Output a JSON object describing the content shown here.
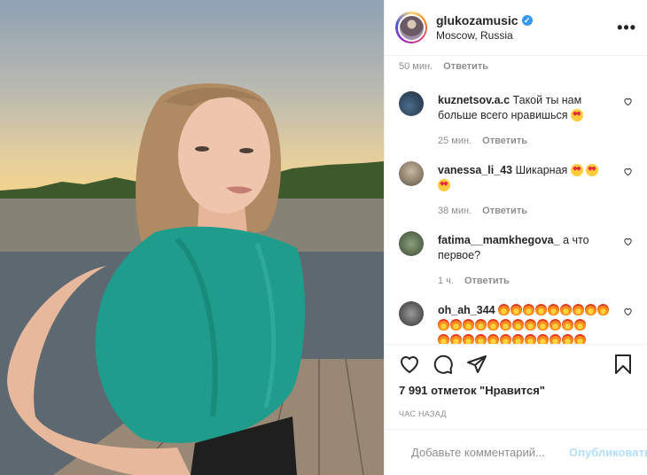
{
  "header": {
    "username": "glukozamusic",
    "location": "Moscow, Russia",
    "more_label": "•••"
  },
  "comments": [
    {
      "username": "",
      "text": "",
      "time": "50 мин.",
      "reply": "Ответить"
    },
    {
      "username": "kuznetsov.a.c",
      "text": "Такой ты нам больше всего нравишься",
      "time": "25 мин.",
      "reply": "Ответить"
    },
    {
      "username": "vanessa_li_43",
      "text": "Шикарная",
      "time": "38 мин.",
      "reply": "Ответить"
    },
    {
      "username": "fatima__mamkhegova_",
      "text": "а что первое?",
      "time": "1 ч.",
      "reply": "Ответить"
    },
    {
      "username": "oh_ah_344",
      "text": "",
      "time": "",
      "reply": ""
    }
  ],
  "likes": "7 991 отметок \"Нравится\"",
  "timestamp": "ЧАС НАЗАД",
  "add_comment": {
    "placeholder": "Добавьте комментарий...",
    "publish_label": "Опубликовать"
  },
  "colors": {
    "verified": "#3897f0",
    "publish_disabled": "#b2dffc",
    "secondary_text": "#8e8e8e"
  }
}
